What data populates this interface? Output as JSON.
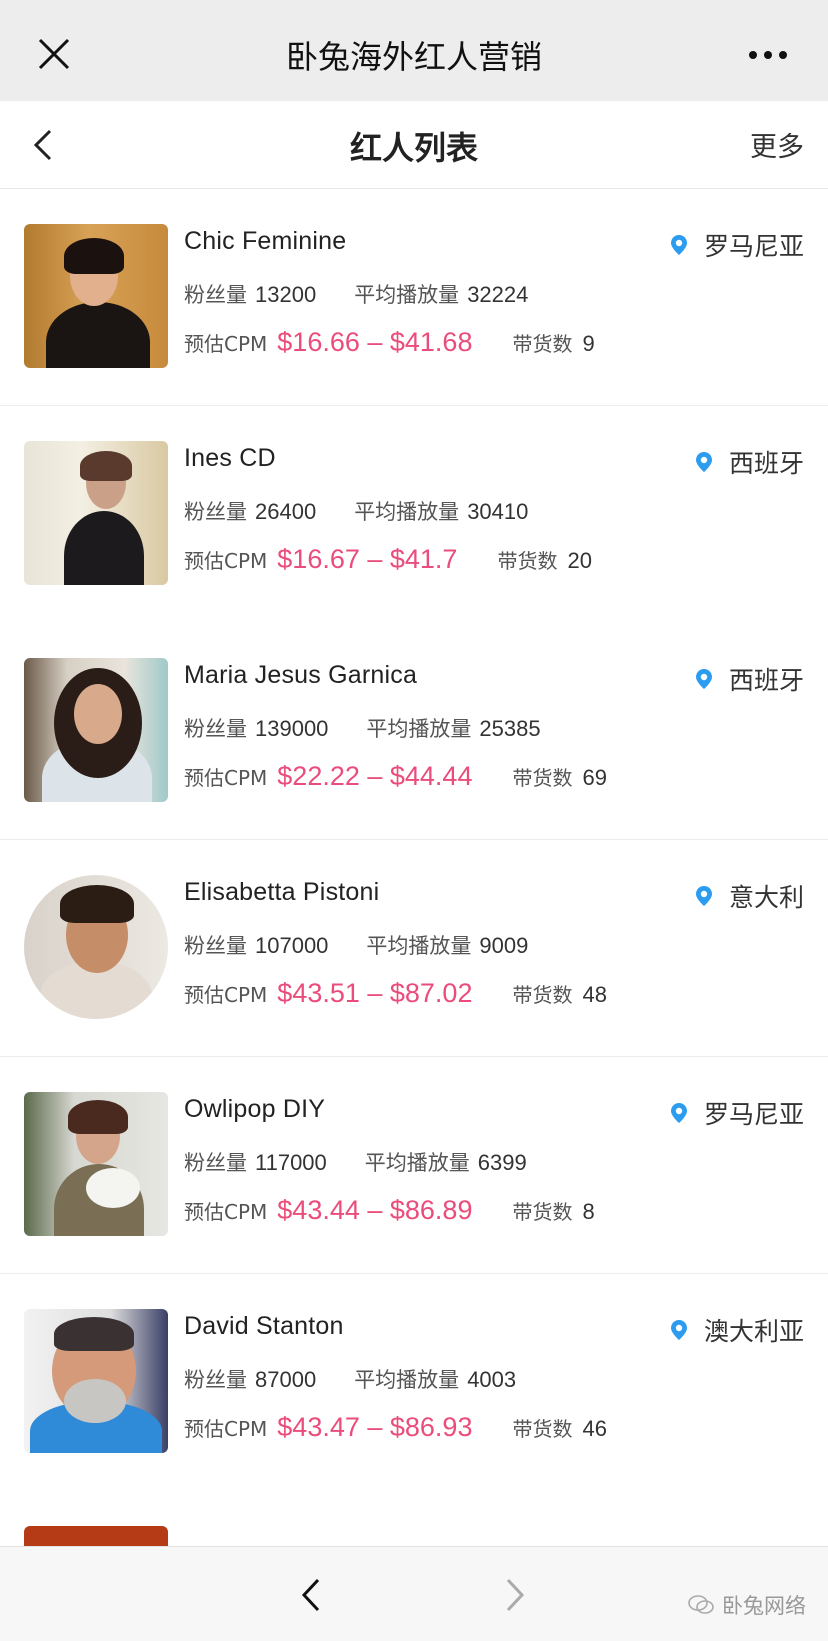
{
  "window": {
    "title": "卧兔海外红人营销"
  },
  "header": {
    "title": "红人列表",
    "more_label": "更多"
  },
  "labels": {
    "followers": "粉丝量",
    "avg_views": "平均播放量",
    "cpm": "预估CPM",
    "sales": "带货数"
  },
  "influencers": [
    {
      "name": "Chic Feminine",
      "location": "罗马尼亚",
      "followers": "13200",
      "avg_views": "32224",
      "cpm": "$16.66 – $41.68",
      "sales": "9"
    },
    {
      "name": "Ines CD",
      "location": "西班牙",
      "followers": "26400",
      "avg_views": "30410",
      "cpm": "$16.67 – $41.7",
      "sales": "20"
    },
    {
      "name": "Maria Jesus Garnica",
      "location": "西班牙",
      "followers": "139000",
      "avg_views": "25385",
      "cpm": "$22.22 – $44.44",
      "sales": "69"
    },
    {
      "name": "Elisabetta Pistoni",
      "location": "意大利",
      "followers": "107000",
      "avg_views": "9009",
      "cpm": "$43.51 – $87.02",
      "sales": "48"
    },
    {
      "name": "Owlipop DIY",
      "location": "罗马尼亚",
      "followers": "117000",
      "avg_views": "6399",
      "cpm": "$43.44 – $86.89",
      "sales": "8"
    },
    {
      "name": "David Stanton",
      "location": "澳大利亚",
      "followers": "87000",
      "avg_views": "4003",
      "cpm": "$43.47 – $86.93",
      "sales": "46"
    }
  ],
  "watermark": "卧兔网络",
  "colors": {
    "price": "#ea4c7b",
    "pin": "#2c9cf0",
    "topbar_bg": "#ededed"
  }
}
